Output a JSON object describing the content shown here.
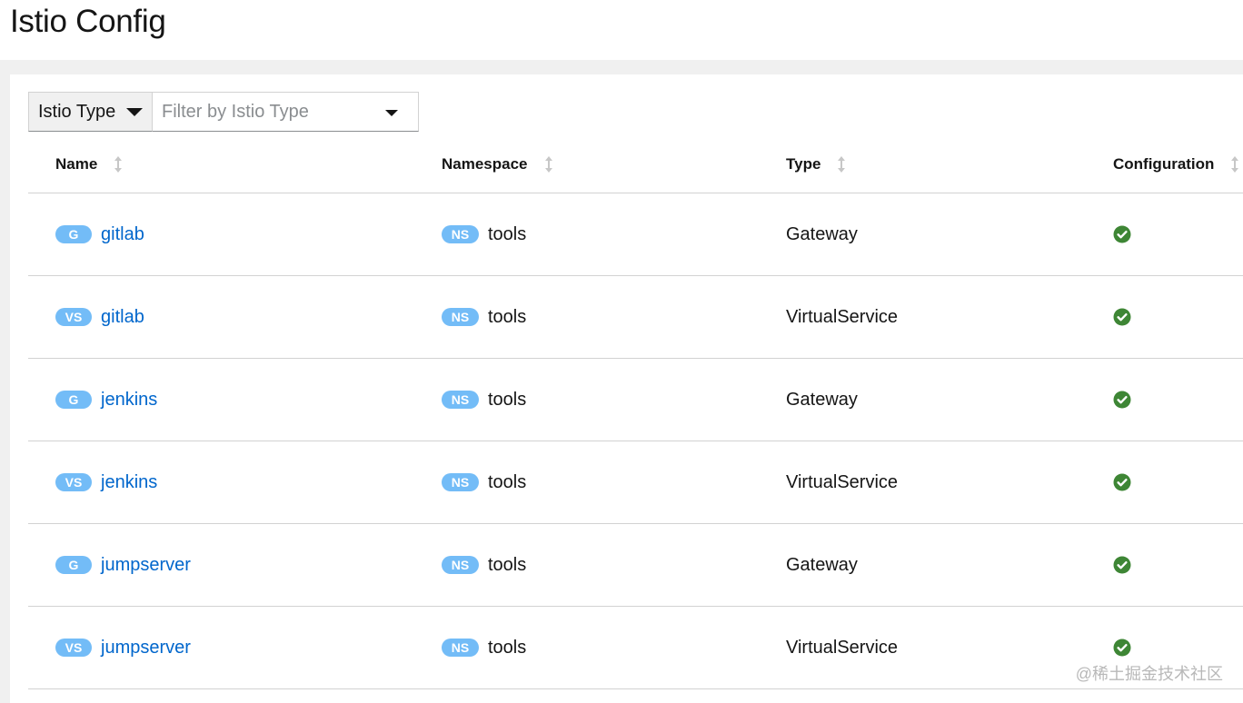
{
  "page": {
    "title": "Istio Config"
  },
  "toolbar": {
    "type_select_label": "Istio Type",
    "filter_placeholder": "Filter by Istio Type"
  },
  "table": {
    "columns": [
      {
        "label": "Name"
      },
      {
        "label": "Namespace"
      },
      {
        "label": "Type"
      },
      {
        "label": "Configuration"
      }
    ],
    "rows": [
      {
        "badge": "G",
        "name": "gitlab",
        "ns_badge": "NS",
        "namespace": "tools",
        "type": "Gateway",
        "config_status": "valid"
      },
      {
        "badge": "VS",
        "name": "gitlab",
        "ns_badge": "NS",
        "namespace": "tools",
        "type": "VirtualService",
        "config_status": "valid"
      },
      {
        "badge": "G",
        "name": "jenkins",
        "ns_badge": "NS",
        "namespace": "tools",
        "type": "Gateway",
        "config_status": "valid"
      },
      {
        "badge": "VS",
        "name": "jenkins",
        "ns_badge": "NS",
        "namespace": "tools",
        "type": "VirtualService",
        "config_status": "valid"
      },
      {
        "badge": "G",
        "name": "jumpserver",
        "ns_badge": "NS",
        "namespace": "tools",
        "type": "Gateway",
        "config_status": "valid"
      },
      {
        "badge": "VS",
        "name": "jumpserver",
        "ns_badge": "NS",
        "namespace": "tools",
        "type": "VirtualService",
        "config_status": "valid"
      }
    ]
  },
  "icons": {
    "type_caret": "caret-down-icon",
    "filter_caret": "caret-down-icon",
    "sort": "sort-icon",
    "config_valid": "check-circle-icon"
  },
  "colors": {
    "link": "#0066cc",
    "badge": "#73bcf7",
    "valid": "#3e8635"
  },
  "watermark": "@稀土掘金技术社区"
}
